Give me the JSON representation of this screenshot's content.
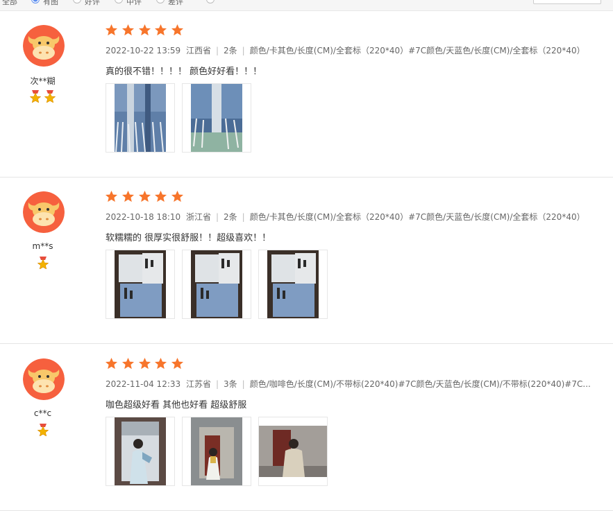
{
  "filter_bar": {
    "items": [
      {
        "label": "全部",
        "checked": false
      },
      {
        "label": "有图",
        "checked": true
      },
      {
        "label": "好评",
        "checked": false
      },
      {
        "label": "中评",
        "checked": false
      },
      {
        "label": "差评",
        "checked": false
      }
    ]
  },
  "reviews": [
    {
      "username": "次**糊",
      "medals": 2,
      "rating": 5,
      "date": "2022-10-22 13:59",
      "province": "江西省",
      "quantity": "2条",
      "spec": "颜色/卡其色/长度(CM)/全套标（220*40）#7C颜色/天蓝色/长度(CM)/全套标（220*40）",
      "content": "真的很不错！！！！ 颜色好好看！！！",
      "photos": [
        "scarf-blue-plaid-photo",
        "scarf-blue-green-photo"
      ]
    },
    {
      "username": "m**s",
      "medals": 1,
      "rating": 5,
      "date": "2022-10-18 18:10",
      "province": "浙江省",
      "quantity": "2条",
      "spec": "颜色/卡其色/长度(CM)/全套标（220*40）#7C颜色/天蓝色/长度(CM)/全套标（220*40）",
      "content": "软糯糯的 很厚实很舒服！！超级喜欢！！",
      "photos": [
        "scarf-package-photo",
        "scarf-package-photo",
        "scarf-package-photo"
      ]
    },
    {
      "username": "c**c",
      "medals": 1,
      "rating": 5,
      "date": "2022-11-04 12:33",
      "province": "江苏省",
      "quantity": "3条",
      "spec": "颜色/咖啡色/长度(CM)/不带标(220*40)#7C颜色/天蓝色/长度(CM)/不带标(220*40)#7C...",
      "content": "咖色超级好看 其他也好看 超级舒服",
      "photos": [
        "mirror-selfie-photo",
        "mirror-selfie-photo",
        "mirror-selfie-photo"
      ]
    }
  ],
  "colors": {
    "star": "#f7752b",
    "avatar_bg": "#f6603e",
    "bull_face": "#f8c86a",
    "medal": "#f3b200"
  }
}
